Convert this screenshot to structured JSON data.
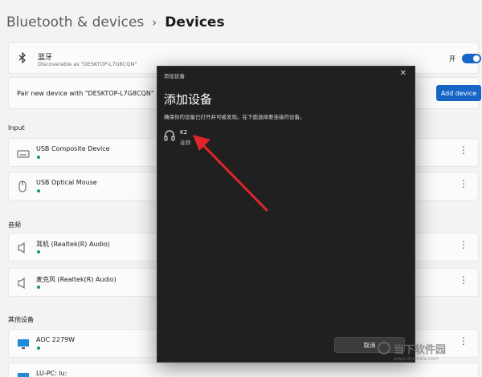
{
  "breadcrumb": {
    "parent": "Bluetooth & devices",
    "separator": "›",
    "current": "Devices"
  },
  "bluetooth": {
    "name": "蓝牙",
    "discoverable": "Discoverable as \"DESKTOP-L7G8CQN\"",
    "toggle_label": "开",
    "enabled": true
  },
  "pair": {
    "text": "Pair new device with \"DESKTOP-L7G8CQN\"",
    "button": "Add device"
  },
  "sections": {
    "input": "Input",
    "audio": "音频",
    "other": "其他设备"
  },
  "devices": {
    "input": [
      {
        "name": "USB Composite Device",
        "icon": "keyboard-icon"
      },
      {
        "name": "USB Optical Mouse",
        "icon": "mouse-icon"
      }
    ],
    "audio": [
      {
        "name": "耳机 (Realtek(R) Audio)",
        "icon": "speaker-icon"
      },
      {
        "name": "麦克风 (Realtek(R) Audio)",
        "icon": "speaker-icon"
      }
    ],
    "other": [
      {
        "name": "AOC 2279W",
        "icon": "monitor-icon"
      },
      {
        "name": "LU-PC: lu:",
        "icon": "monitor-icon"
      }
    ]
  },
  "dialog": {
    "titlebar": "添加设备",
    "close": "✕",
    "title": "添加设备",
    "description": "确保你的设备已打开并可被发现。在下面选择要连接的设备。",
    "found_device": {
      "name": "K2",
      "type": "音频",
      "icon": "headphones-icon"
    },
    "cancel": "取消"
  },
  "watermark": {
    "text": "当下软件园",
    "sub": "www.downxia.com"
  },
  "colors": {
    "accent": "#1666c5",
    "arrow": "#e0262b",
    "dialog_bg": "#202020",
    "status_green": "#0f9d58"
  }
}
